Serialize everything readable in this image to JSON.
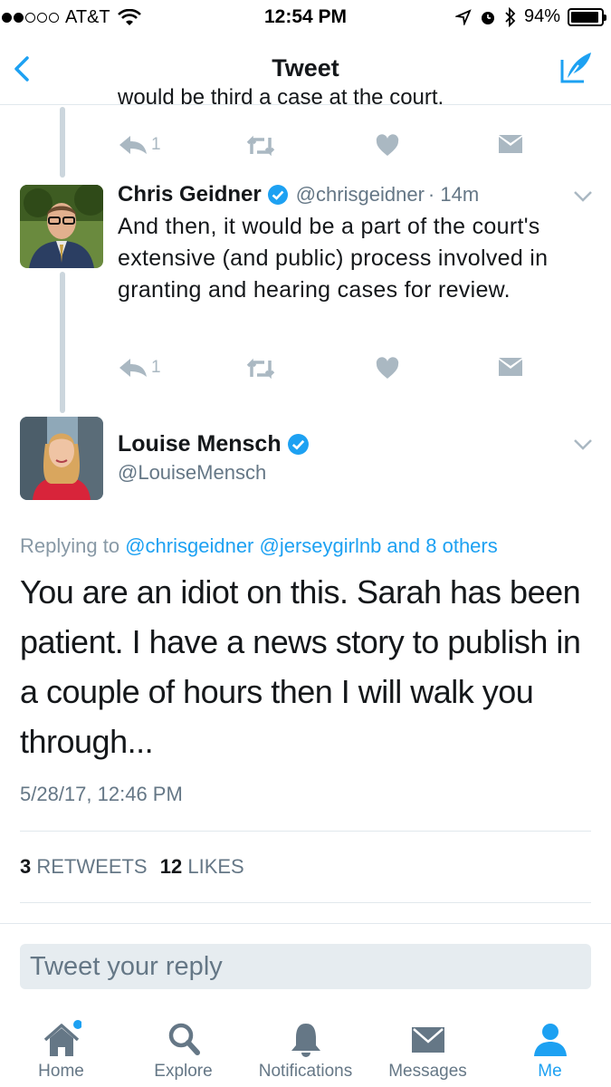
{
  "status_bar": {
    "carrier": "AT&T",
    "time": "12:54 PM",
    "battery": "94%",
    "battery_level": 0.94
  },
  "nav": {
    "title": "Tweet"
  },
  "thread": {
    "clipped_text": "would be third a case at the court.",
    "prev_reply_count": "1",
    "tweet": {
      "name": "Chris Geidner",
      "handle": "@chrisgeidner",
      "time": "· 14m",
      "text": "And then, it would be a part of the court's extensive (and public) process involved in granting and hearing cases for review.",
      "reply_count": "1"
    }
  },
  "main_tweet": {
    "name": "Louise Mensch",
    "handle": "@LouiseMensch",
    "replying_prefix": "Replying to",
    "replying_targets": "@chrisgeidner @jerseygirlnb and 8 others",
    "text": "You are an idiot on this.  Sarah has been patient. I have a news story to publish in a couple of hours then I will walk you through...",
    "timestamp": "5/28/17, 12:46 PM",
    "retweets_count": "3",
    "retweets_label": "RETWEETS",
    "likes_count": "12",
    "likes_label": "LIKES"
  },
  "reply": {
    "placeholder": "Tweet your reply"
  },
  "tabs": [
    {
      "label": "Home",
      "icon": "home-icon"
    },
    {
      "label": "Explore",
      "icon": "search-icon"
    },
    {
      "label": "Notifications",
      "icon": "bell-icon"
    },
    {
      "label": "Messages",
      "icon": "envelope-icon"
    },
    {
      "label": "Me",
      "icon": "person-icon"
    }
  ],
  "colors": {
    "accent": "#1da1f2",
    "muted": "#657786",
    "icon_gray": "#aab8c2",
    "verified": "#1da1f2"
  }
}
